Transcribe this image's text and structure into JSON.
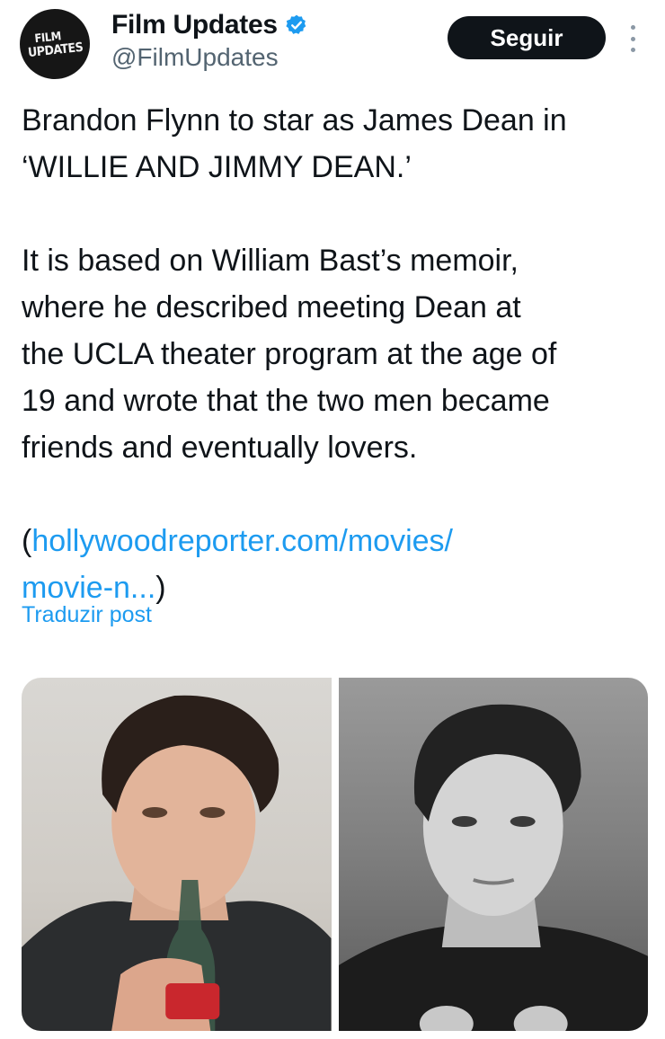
{
  "author": {
    "avatar_text_line1": "FILM",
    "avatar_text_line2": "UPDATES",
    "display_name": "Film Updates",
    "handle": "@FilmUpdates",
    "verified": true
  },
  "actions": {
    "follow_label": "Seguir",
    "more_icon": "more-vertical-icon"
  },
  "tweet": {
    "line1": "Brandon Flynn to star as James Dean in",
    "line2": "‘WILLIE AND JIMMY DEAN.’",
    "para2_line1": "It is based on William Bast’s memoir,",
    "para2_line2": "where he described meeting Dean at",
    "para2_line3": "the UCLA theater program at the age of",
    "para2_line4": "19 and wrote that the two men became",
    "para2_line5": "friends and eventually lovers.",
    "link_open": "(",
    "link_line1": "hollywoodreporter.com/movies/",
    "link_line2": "movie-n...",
    "link_close": ")"
  },
  "translate_label": "Traduzir post",
  "colors": {
    "accent": "#1d9bf0",
    "text": "#0f1419",
    "secondary": "#536471",
    "button_bg": "#0f1419"
  }
}
